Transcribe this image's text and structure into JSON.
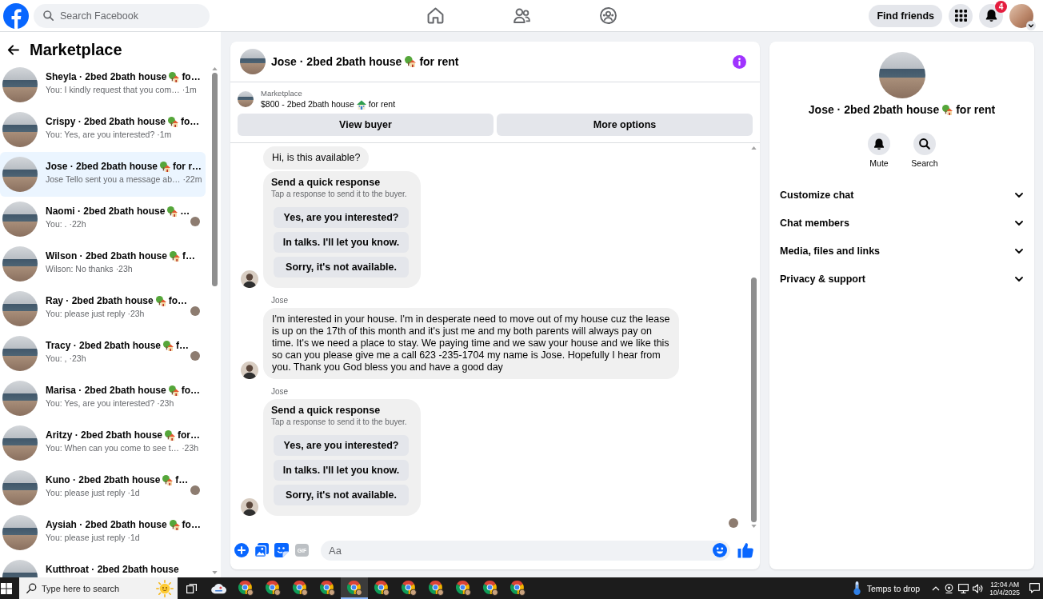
{
  "top_bar": {
    "search_placeholder": "Search Facebook",
    "find_friends": "Find friends",
    "notification_count": "4"
  },
  "sidebar": {
    "title": "Marketplace",
    "conversations": [
      {
        "title": "Sheyla · 2bed 2bath house",
        "title_end": "fo…",
        "preview": "You: I kindly request that you com…",
        "time": "·1m",
        "selected": false,
        "seen": false
      },
      {
        "title": "Crispy · 2bed 2bath house",
        "title_end": "fo…",
        "preview": "You: Yes, are you interested?",
        "time": "·1m",
        "selected": false,
        "seen": false
      },
      {
        "title": "Jose · 2bed 2bath house",
        "title_end": "for r…",
        "preview": "Jose Tello sent you a message ab…",
        "time": "·22m",
        "selected": true,
        "seen": false
      },
      {
        "title": "Naomi · 2bed 2bath house",
        "title_end": "…",
        "preview": "You: .",
        "time": "·22h",
        "selected": false,
        "seen": true
      },
      {
        "title": "Wilson · 2bed 2bath house",
        "title_end": "f…",
        "preview": "Wilson: No thanks",
        "time": "·23h",
        "selected": false,
        "seen": false
      },
      {
        "title": "Ray · 2bed 2bath house",
        "title_end": "fo…",
        "preview": "You: please just reply",
        "time": "·23h",
        "selected": false,
        "seen": true
      },
      {
        "title": "Tracy · 2bed 2bath house",
        "title_end": "f…",
        "preview": "You: ,",
        "time": "·23h",
        "selected": false,
        "seen": true
      },
      {
        "title": "Marisa · 2bed 2bath house",
        "title_end": "fo…",
        "preview": "You: Yes, are you interested?",
        "time": "·23h",
        "selected": false,
        "seen": false
      },
      {
        "title": "Aritzy · 2bed 2bath house",
        "title_end": "for…",
        "preview": "You: When can you come to see t…",
        "time": "·23h",
        "selected": false,
        "seen": false
      },
      {
        "title": "Kuno · 2bed 2bath house",
        "title_end": "f…",
        "preview": "You: please just reply",
        "time": "·1d",
        "selected": false,
        "seen": true
      },
      {
        "title": "Aysiah · 2bed 2bath house",
        "title_end": "fo…",
        "preview": "You: please just reply",
        "time": "·1d",
        "selected": false,
        "seen": false
      },
      {
        "title": "Kutthroat · 2bed 2bath house",
        "selected": false,
        "seen": false
      }
    ]
  },
  "chat": {
    "title": "Jose · 2bed 2bath house",
    "title_end": "for rent",
    "listing": {
      "label": "Marketplace",
      "title": "$800 - 2bed 2bath house",
      "title_end": "for rent"
    },
    "buttons": [
      "View buyer",
      "More options"
    ],
    "message_groups": [
      {
        "messages": [
          {
            "kind": "text",
            "text": "Hi, is this available?"
          },
          {
            "kind": "quick_response",
            "title": "Send a quick response",
            "hint": "Tap a response to send it to the buyer.",
            "options": [
              "Yes, are you interested?",
              "In talks. I'll let you know.",
              "Sorry, it's not available."
            ]
          }
        ]
      },
      {
        "sender": "Jose",
        "messages": [
          {
            "kind": "text",
            "text": "I'm interested in your house. I'm in desperate need to move out of my house cuz the lease is up on the 17th of this month and it's just me and my both parents will always pay on time. It's we need a place to stay. We paying time and we saw your house and we like this so can you please give me a call 623 -235-1704 my name is Jose. Hopefully I hear from you. Thank you God bless you and have a good day"
          }
        ]
      },
      {
        "sender": "Jose",
        "messages": [
          {
            "kind": "quick_response",
            "title": "Send a quick response",
            "hint": "Tap a response to send it to the buyer.",
            "options": [
              "Yes, are you interested?",
              "In talks. I'll let you know.",
              "Sorry, it's not available."
            ]
          }
        ]
      }
    ],
    "seen": true,
    "composer": {
      "gif_label": "GIF",
      "placeholder": "Aa"
    }
  },
  "details": {
    "title": "Jose · 2bed 2bath house",
    "title_end": "for rent",
    "actions": [
      {
        "kind": "mute",
        "label": "Mute"
      },
      {
        "kind": "search",
        "label": "Search"
      }
    ],
    "sections": [
      {
        "label": "Customize chat",
        "expanded": false
      },
      {
        "label": "Chat members",
        "expanded": false
      },
      {
        "label": "Media, files and links",
        "expanded": false
      },
      {
        "label": "Privacy & support",
        "expanded": false
      }
    ]
  },
  "taskbar": {
    "search_placeholder": "Type here to search",
    "apps": [
      {
        "kind": "cloud",
        "selected": false
      },
      {
        "kind": "browser",
        "selected": false
      },
      {
        "kind": "browser",
        "selected": false
      },
      {
        "kind": "browser",
        "selected": false
      },
      {
        "kind": "browser",
        "selected": false
      },
      {
        "kind": "browser",
        "selected": true
      },
      {
        "kind": "browser",
        "selected": false
      },
      {
        "kind": "browser",
        "selected": false
      },
      {
        "kind": "browser",
        "selected": false
      },
      {
        "kind": "browser",
        "selected": false
      },
      {
        "kind": "browser",
        "selected": false
      },
      {
        "kind": "browser",
        "selected": false
      }
    ],
    "weather": "Temps to drop",
    "time": "12:04 AM",
    "date": "10/4/2025"
  }
}
